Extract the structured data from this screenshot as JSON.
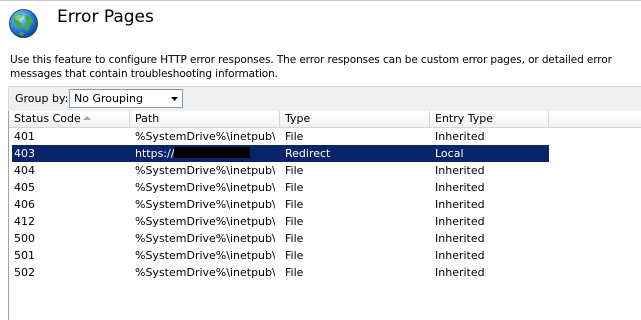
{
  "header": {
    "title": "Error Pages",
    "description": "Use this feature to configure HTTP error responses. The error responses can be custom error pages, or detailed error messages that contain troubleshooting information."
  },
  "toolbar": {
    "group_by_label": "Group by:",
    "group_by_value": "No Grouping"
  },
  "table": {
    "columns": [
      "Status Code",
      "Path",
      "Type",
      "Entry Type"
    ],
    "sort_column": "Status Code",
    "selected_row": 1,
    "rows": [
      {
        "status": "401",
        "path": "%SystemDrive%\\inetpub\\...",
        "type": "File",
        "entry": "Inherited"
      },
      {
        "status": "403",
        "path": "https://",
        "type": "Redirect",
        "entry": "Local",
        "redacted": true
      },
      {
        "status": "404",
        "path": "%SystemDrive%\\inetpub\\...",
        "type": "File",
        "entry": "Inherited"
      },
      {
        "status": "405",
        "path": "%SystemDrive%\\inetpub\\...",
        "type": "File",
        "entry": "Inherited"
      },
      {
        "status": "406",
        "path": "%SystemDrive%\\inetpub\\...",
        "type": "File",
        "entry": "Inherited"
      },
      {
        "status": "412",
        "path": "%SystemDrive%\\inetpub\\...",
        "type": "File",
        "entry": "Inherited"
      },
      {
        "status": "500",
        "path": "%SystemDrive%\\inetpub\\...",
        "type": "File",
        "entry": "Inherited"
      },
      {
        "status": "501",
        "path": "%SystemDrive%\\inetpub\\...",
        "type": "File",
        "entry": "Inherited"
      },
      {
        "status": "502",
        "path": "%SystemDrive%\\inetpub\\...",
        "type": "File",
        "entry": "Inherited"
      }
    ]
  },
  "icons": {
    "feature_icon": "globe-icon",
    "combo_arrow": "dropdown-arrow-icon",
    "sort_indicator": "sort-ascending-icon"
  },
  "colors": {
    "selection": "#0a246a",
    "header_border": "#d5d5d5"
  }
}
